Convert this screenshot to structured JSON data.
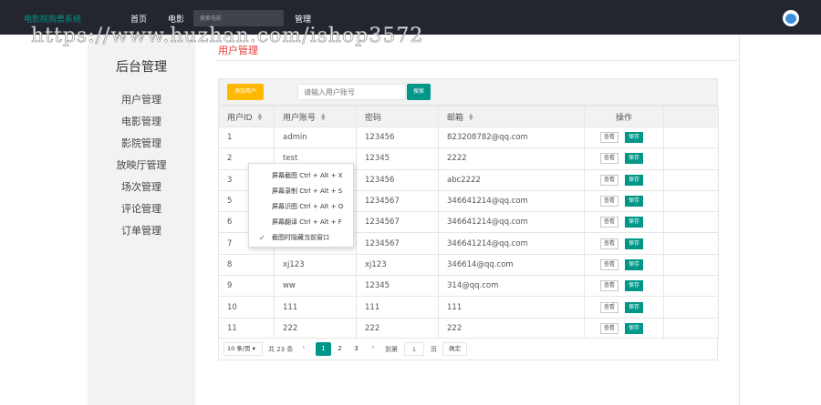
{
  "topbar": {
    "brand": "电影院购票系统",
    "nav": [
      "首页",
      "电影"
    ],
    "search_placeholder": "搜索电影",
    "manage": "管理"
  },
  "watermark": "https://www.huzhan.com/ishop3572",
  "sidebar": {
    "title": "后台管理",
    "items": [
      "用户管理",
      "电影管理",
      "影院管理",
      "放映厅管理",
      "场次管理",
      "评论管理",
      "订单管理"
    ]
  },
  "page": {
    "tab": "用户管理"
  },
  "toolbar": {
    "add_label": "添加用户",
    "search_placeholder": "请输入用户账号",
    "search_label": "搜索"
  },
  "table": {
    "columns": [
      "用户ID",
      "用户账号",
      "密码",
      "邮箱",
      "操作"
    ],
    "view_label": "查看",
    "save_label": "保存",
    "rows": [
      [
        "1",
        "admin",
        "123456",
        "823208782@qq.com"
      ],
      [
        "2",
        "test",
        "12345",
        "2222"
      ],
      [
        "3",
        "",
        "123456",
        "abc2222"
      ],
      [
        "5",
        "",
        "1234567",
        "346641214@qq.com"
      ],
      [
        "6",
        "",
        "1234567",
        "346641214@qq.com"
      ],
      [
        "7",
        "",
        "1234567",
        "346641214@qq.com"
      ],
      [
        "8",
        "xj123",
        "xj123",
        "346614@qq.com"
      ],
      [
        "9",
        "ww",
        "12345",
        "314@qq.com"
      ],
      [
        "10",
        "111",
        "111",
        "111"
      ],
      [
        "11",
        "222",
        "222",
        "222"
      ]
    ]
  },
  "pagination": {
    "page_size": "10 条/页",
    "total": "共 23 条",
    "pages": [
      "1",
      "2",
      "3"
    ],
    "current": "1",
    "goto_label": "到第",
    "goto_value": "1",
    "page_unit": "页",
    "confirm": "确定"
  },
  "context_menu": {
    "items": [
      "屏幕截图 Ctrl + Alt + X",
      "屏幕录制 Ctrl + Alt + S",
      "屏幕识图 Ctrl + Alt + O",
      "屏幕翻译 Ctrl + Alt + F",
      "截图时隐藏当前窗口"
    ]
  },
  "colors": {
    "topbar": "#23262e",
    "brand": "#009688",
    "warning": "#ffb800",
    "primary": "#009688",
    "active_tab": "#e93a3a"
  }
}
